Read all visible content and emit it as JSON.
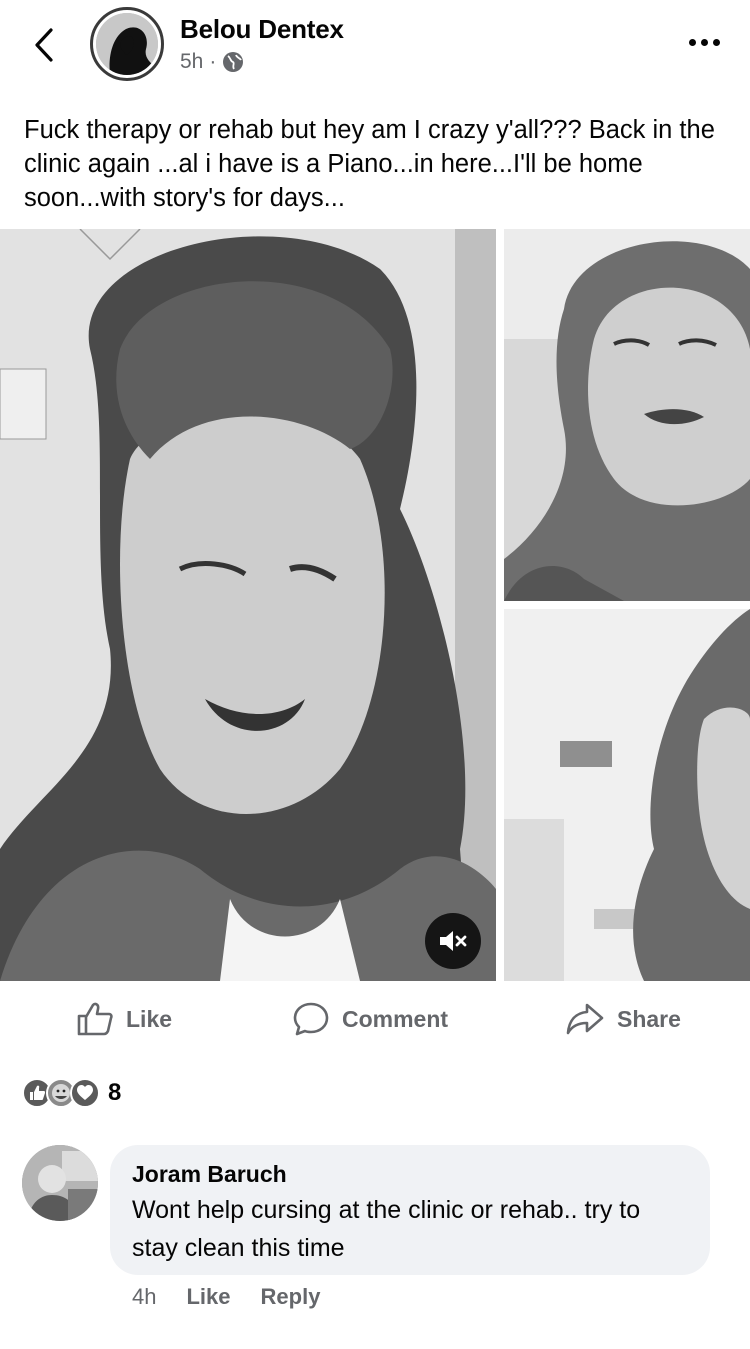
{
  "post": {
    "author": "Belou Dentex",
    "time": "5h",
    "separator": "·",
    "text": "Fuck therapy or rehab but hey am I crazy y'all??? Back in the clinic again ...al i have is a Piano...in here...I'll be home soon...with story's for days..."
  },
  "icons": {
    "back": "chevron-left-icon",
    "audience": "globe-icon",
    "more": "more-horizontal-icon",
    "mute": "volume-muted-icon",
    "like": "thumbs-up-icon",
    "comment": "comment-bubble-icon",
    "share": "share-arrow-icon"
  },
  "actions": {
    "like_label": "Like",
    "comment_label": "Comment",
    "share_label": "Share"
  },
  "reactions": {
    "types": [
      "like",
      "care",
      "love"
    ],
    "count": "8"
  },
  "comment": {
    "name": "Joram Baruch",
    "text": "Wont help cursing at the clinic or rehab.. try to stay clean this time",
    "time": "4h",
    "like_label": "Like",
    "reply_label": "Reply"
  },
  "colors": {
    "text_primary": "#050505",
    "text_secondary": "#65676b",
    "bubble_bg": "#f0f2f5"
  }
}
